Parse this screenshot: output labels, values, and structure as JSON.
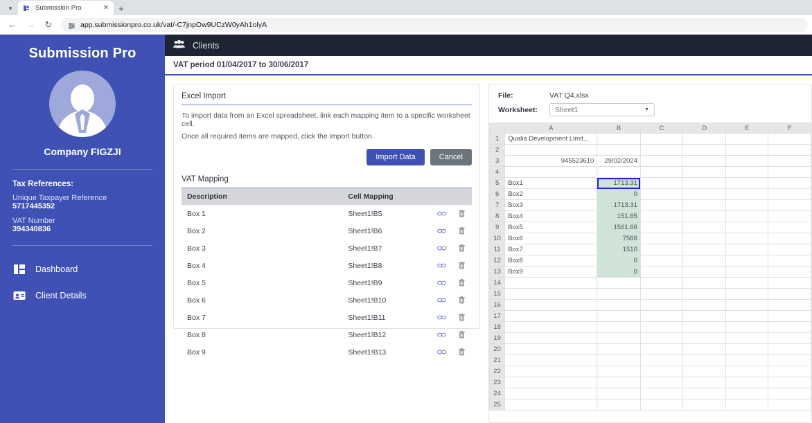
{
  "browser": {
    "tab_list_icon": "chevron-down-icon",
    "tab": {
      "title": "Submission Pro",
      "favicon": "submission-pro-favicon",
      "close_icon": "close-icon"
    },
    "new_tab_icon": "plus-icon",
    "back_icon": "arrow-left-icon",
    "forward_icon": "arrow-right-icon",
    "reload_icon": "reload-icon",
    "site_info_icon": "site-settings-icon",
    "url": "app.submissionpro.co.uk/vat/-C7jnpOw9UCzW0yAh1olyA"
  },
  "sidebar": {
    "brand": "Submission Pro",
    "avatar_icon": "user-avatar-icon",
    "company": "Company FIGZJI",
    "tax_heading": "Tax References:",
    "refs": [
      {
        "label": "Unique Taxpayer Reference",
        "value": "5717445352"
      },
      {
        "label": "VAT Number",
        "value": "394340836"
      }
    ],
    "nav": [
      {
        "label": "Dashboard",
        "icon": "dashboard-icon"
      },
      {
        "label": "Client Details",
        "icon": "id-card-icon"
      }
    ]
  },
  "topbar": {
    "icon": "people-icon",
    "title": "Clients"
  },
  "period_bar": {
    "text": "VAT period 01/04/2017 to 30/06/2017"
  },
  "import_card": {
    "heading": "Excel Import",
    "help_lines": [
      "To import data from an Excel spreadsheet, link each mapping item to a specific worksheet cell.",
      "Once all required items are mapped, click the import button."
    ],
    "import_button": "Import Data",
    "cancel_button": "Cancel",
    "mapping_heading": "VAT Mapping",
    "columns": [
      "Description",
      "Cell Mapping"
    ],
    "rows": [
      {
        "description": "Box 1",
        "cell": "Sheet1!B5"
      },
      {
        "description": "Box 2",
        "cell": "Sheet1!B6"
      },
      {
        "description": "Box 3",
        "cell": "Sheet1!B7"
      },
      {
        "description": "Box 4",
        "cell": "Sheet1!B8"
      },
      {
        "description": "Box 5",
        "cell": "Sheet1!B9"
      },
      {
        "description": "Box 6",
        "cell": "Sheet1!B10"
      },
      {
        "description": "Box 7",
        "cell": "Sheet1!B11"
      },
      {
        "description": "Box 8",
        "cell": "Sheet1!B12"
      },
      {
        "description": "Box 9",
        "cell": "Sheet1!B13"
      }
    ],
    "row_link_icon": "link-icon",
    "row_delete_icon": "trash-icon"
  },
  "sheet_panel": {
    "file_label": "File:",
    "file_name": "VAT Q4.xlsx",
    "worksheet_label": "Worksheet:",
    "worksheet_value": "Sheet1",
    "worksheet_caret_icon": "chevron-down-icon",
    "columns": [
      "A",
      "B",
      "C",
      "D",
      "E",
      "F"
    ],
    "row_count": 25,
    "selected_cell": "B5",
    "shaded_column": "B",
    "shaded_rows": [
      5,
      6,
      7,
      8,
      9,
      10,
      11,
      12,
      13
    ],
    "cells": {
      "A1": "Qualia Development Limit...",
      "A3": "945523610",
      "B3": "29/02/2024",
      "A5": "Box1",
      "B5": "1713.31",
      "A6": "Box2",
      "B6": "0",
      "A7": "Box3",
      "B7": "1713.31",
      "A8": "Box4",
      "B8": "151.65",
      "A9": "Box5",
      "B9": "1561.66",
      "A10": "Box6",
      "B10": "7566",
      "A11": "Box7",
      "B11": "1510",
      "A12": "Box8",
      "B12": "0",
      "A13": "Box9",
      "B13": "0"
    },
    "right_aligned_cells": [
      "A3",
      "B3",
      "B5",
      "B6",
      "B7",
      "B8",
      "B9",
      "B10",
      "B11",
      "B12",
      "B13"
    ]
  },
  "colors": {
    "brand": "#3f51b5",
    "topbar": "#1f2433",
    "shaded_cell": "#cfe3d8",
    "selection_border": "#2222dd",
    "cancel": "#6c757d"
  }
}
